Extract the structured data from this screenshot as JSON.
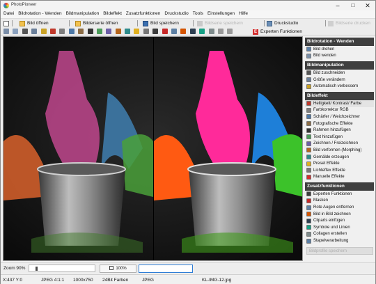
{
  "app": {
    "title": "PhotoPioneer"
  },
  "menu": [
    "Datei",
    "Bildrotation - Wenden",
    "Bildmanipulation",
    "Bildeffekt",
    "Zusatzfunktionen",
    "Druckstudio",
    "Tools",
    "Einstellungen",
    "Hilfe"
  ],
  "toolbar": {
    "open_label": "Bild öffnen",
    "series_label": "Bilderserie öffnen",
    "save_label": "Bild speichern",
    "save_series_label": "Bildserie speichern",
    "print_label": "Druckstudio",
    "print_series_label": "Bildserie drucken",
    "expert_label": "Experten Funktionen"
  },
  "sidebar": {
    "sections": [
      {
        "title": "Bildrotation - Wenden",
        "items": [
          "Bild drehen",
          "Bild wenden"
        ]
      },
      {
        "title": "Bildmanipulation",
        "items": [
          "Bild zuschneiden",
          "Größe verändern",
          "Automatisch verbessern"
        ]
      },
      {
        "title": "Bildeffekt",
        "items": [
          "Helligkeit/ Kontrast/ Farbe",
          "Farbkorrektur RGB",
          "Schärfer / Weichzeichner",
          "Fotografische Effekte",
          "Rahmen hinzufügen",
          "Text hinzufügen",
          "Zeichnen / Freizeichnen",
          "Bild verformen (Morphing)",
          "Gemälde erzeugen",
          "Preset Effekte",
          "Lichteffex Effekte",
          "Manuelle Effekte"
        ]
      },
      {
        "title": "Zusatzfunktionen",
        "items": [
          "Experten Funktionen",
          "Masken",
          "Rote Augen entfernen",
          "Bild in Bild zeichnen",
          "Cliparts einfügen",
          "Symbole und Linien",
          "Collagen erstellen",
          "Stapelverarbeitung"
        ]
      }
    ],
    "bottom_field": "Bildprofile speichern"
  },
  "zoom": {
    "label": "Zoom 90%",
    "button_label": "100%",
    "slider_value_percent": 90
  },
  "status": {
    "coords": "X:437 Y:0",
    "format": "JPEG  4:1:1",
    "dimensions": "1000x750",
    "colors": "24Bit Farben",
    "type": "JPEG",
    "filename": "KL-IMG-12.jpg"
  },
  "colors": {
    "header_bg": "#3f3f3f",
    "accent_blue": "#2e7dd6",
    "expert_red": "#d32f2f"
  }
}
